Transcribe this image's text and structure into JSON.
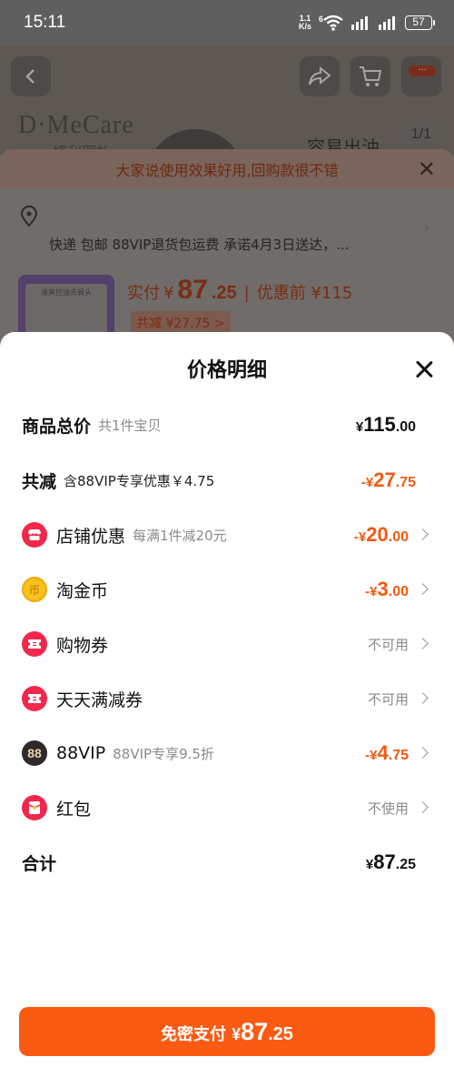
{
  "status_bar": {
    "time": "15:11",
    "net_speed_value": "1.1",
    "net_speed_unit": "K/s",
    "wifi_label": "6",
    "battery": "57"
  },
  "background_page": {
    "brand": "D·MeCare",
    "brand_sub": "姆利图补",
    "slogan": "容易出油",
    "image_counter": "1/1",
    "more_badge": "···",
    "banner_text": "大家说使用效果好用,回购款很不错",
    "delivery_text": "快递 包邮 88VIP退货包运费 承诺4月3日送达，...",
    "pay_label": "实付",
    "pay_currency": "¥",
    "pay_int": "87",
    "pay_dec": ".25",
    "before_label": "优惠前 ¥115",
    "saved_label": "共减 ¥27.75 >",
    "thumb_text": "清爽控油去屑头"
  },
  "sheet": {
    "title": "价格明细",
    "rows": {
      "total_goods": {
        "label": "商品总价",
        "sub": "共1件宝贝",
        "cur": "¥",
        "int": "115",
        "dec": ".00"
      },
      "discount": {
        "label": "共减",
        "sub": "含88VIP专享优惠￥4.75",
        "cur": "-¥",
        "int": "27",
        "dec": ".75"
      },
      "shop_discount": {
        "label": "店铺优惠",
        "sub": "每满1件减20元",
        "cur": "-¥",
        "int": "20",
        "dec": ".00"
      },
      "taojin_coin": {
        "label": "淘金币",
        "cur": "-¥",
        "int": "3",
        "dec": ".00",
        "icon_text": "币"
      },
      "shopping_coupon": {
        "label": "购物券",
        "status": "不可用"
      },
      "daily_coupon": {
        "label": "天天满减券",
        "status": "不可用"
      },
      "vip88": {
        "label": "88VIP",
        "sub": "88VIP专享9.5折",
        "cur": "-¥",
        "int": "4",
        "dec": ".75",
        "icon_text": "88"
      },
      "red_packet": {
        "label": "红包",
        "status": "不使用"
      },
      "grand_total": {
        "label": "合计",
        "cur": "¥",
        "int": "87",
        "dec": ".25"
      }
    },
    "pay_button": {
      "label": "免密支付",
      "cur": "¥",
      "int": "87",
      "dec": ".25"
    }
  },
  "colors": {
    "accent_orange": "#f05a11",
    "button_orange": "#fb5a12",
    "icon_red": "#f2274b",
    "coin_yellow": "#f7c21b"
  }
}
